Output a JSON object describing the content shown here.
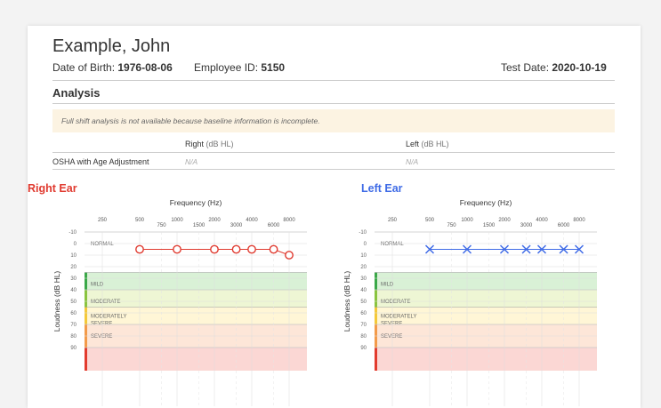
{
  "patient": {
    "name": "Example, John",
    "dob_label": "Date of Birth:",
    "dob": "1976-08-06",
    "employee_label": "Employee ID:",
    "employee_id": "5150",
    "test_date_label": "Test Date:",
    "test_date": "2020-10-19"
  },
  "analysis": {
    "heading": "Analysis",
    "warning": "Full shift analysis is not available because baseline information is incomplete.",
    "col_right": "Right",
    "col_left": "Left",
    "unit": "(dB HL)",
    "row_label": "OSHA with Age Adjustment",
    "right_value": "N/A",
    "left_value": "N/A"
  },
  "audiograms": {
    "right_title": "Right Ear",
    "left_title": "Left Ear",
    "right_color": "#e03a2f",
    "left_color": "#3f6be6",
    "xlabel": "Frequency (Hz)",
    "ylabel": "Loudness (dB HL)",
    "freq_top": [
      "250",
      "500",
      "1000",
      "2000",
      "4000",
      "8000"
    ],
    "freq_bottom": [
      "750",
      "1500",
      "3000",
      "6000"
    ],
    "y_ticks": [
      "-10",
      "0",
      "10",
      "20",
      "30",
      "40",
      "50",
      "60",
      "70",
      "80",
      "90"
    ],
    "bands": [
      {
        "label": "NORMAL",
        "label2": "",
        "from": -10,
        "to": 25,
        "fill": "#ffffff",
        "bar": ""
      },
      {
        "label": "MILD",
        "label2": "",
        "from": 25,
        "to": 40,
        "fill": "#d9f1d6",
        "bar": "#3aa848"
      },
      {
        "label": "MODERATE",
        "label2": "",
        "from": 40,
        "to": 55,
        "fill": "#eef6d4",
        "bar": "#8ac43f"
      },
      {
        "label": "MODERATELY",
        "label2": "SEVERE",
        "from": 55,
        "to": 70,
        "fill": "#fff6d6",
        "bar": "#f4c93a"
      },
      {
        "label": "SEVERE",
        "label2": "",
        "from": 70,
        "to": 90,
        "fill": "#fde6d8",
        "bar": "#f39b4a"
      },
      {
        "label": "",
        "label2": "",
        "from": 90,
        "to": 110,
        "fill": "#fbd7d4",
        "bar": "#e23b2e"
      }
    ]
  },
  "chart_data": [
    {
      "type": "line",
      "title": "Right Ear",
      "xlabel": "Frequency (Hz)",
      "ylabel": "Loudness (dB HL)",
      "x": [
        500,
        1000,
        2000,
        3000,
        4000,
        6000,
        8000
      ],
      "series": [
        {
          "values": [
            5,
            5,
            5,
            5,
            5,
            5,
            10
          ]
        }
      ],
      "xscale": "log",
      "xlim": [
        250,
        8000
      ],
      "ylim": [
        -10,
        90
      ],
      "y_inverted": true,
      "marker": "circle"
    },
    {
      "type": "line",
      "title": "Left Ear",
      "xlabel": "Frequency (Hz)",
      "ylabel": "Loudness (dB HL)",
      "x": [
        500,
        1000,
        2000,
        3000,
        4000,
        6000,
        8000
      ],
      "series": [
        {
          "values": [
            5,
            5,
            5,
            5,
            5,
            5,
            5
          ]
        }
      ],
      "xscale": "log",
      "xlim": [
        250,
        8000
      ],
      "ylim": [
        -10,
        90
      ],
      "y_inverted": true,
      "marker": "x"
    }
  ]
}
